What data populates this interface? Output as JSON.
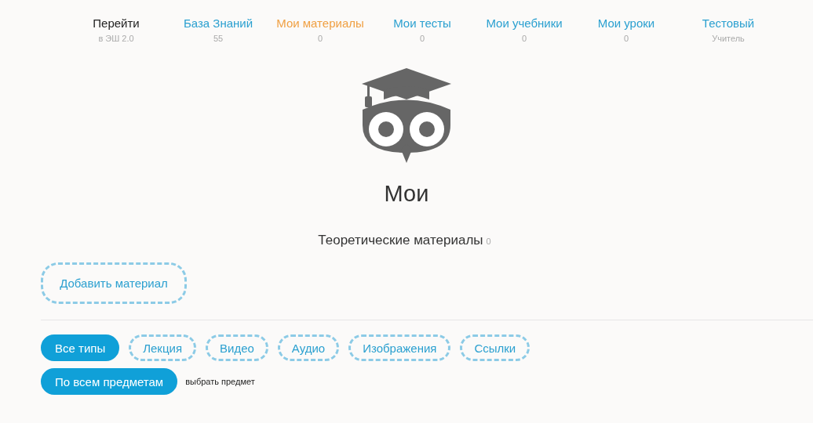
{
  "nav": [
    {
      "kind": "label",
      "label": "Перейти",
      "sub": "в ЭШ 2.0",
      "selected": false
    },
    {
      "kind": "link",
      "label": "База Знаний",
      "sub": "55",
      "selected": false
    },
    {
      "kind": "link",
      "label": "Мои материалы",
      "sub": "0",
      "selected": true
    },
    {
      "kind": "link",
      "label": "Мои тесты",
      "sub": "0",
      "selected": false
    },
    {
      "kind": "link",
      "label": "Мои учебники",
      "sub": "0",
      "selected": false
    },
    {
      "kind": "link",
      "label": "Мои уроки",
      "sub": "0",
      "selected": false
    },
    {
      "kind": "link",
      "label": "Тестовый",
      "sub": "Учитель",
      "selected": false
    }
  ],
  "heading": "Мои",
  "section": {
    "label": "Теоретические материалы",
    "count": "0"
  },
  "add_button": "Добавить материал",
  "type_filters": [
    {
      "label": "Все типы",
      "selected": true
    },
    {
      "label": "Лекция",
      "selected": false
    },
    {
      "label": "Видео",
      "selected": false
    },
    {
      "label": "Аудио",
      "selected": false
    },
    {
      "label": "Изображения",
      "selected": false
    },
    {
      "label": "Ссылки",
      "selected": false
    }
  ],
  "subject_filter": {
    "label": "По всем предметам",
    "selected": true,
    "hint": "выбрать предмет"
  }
}
